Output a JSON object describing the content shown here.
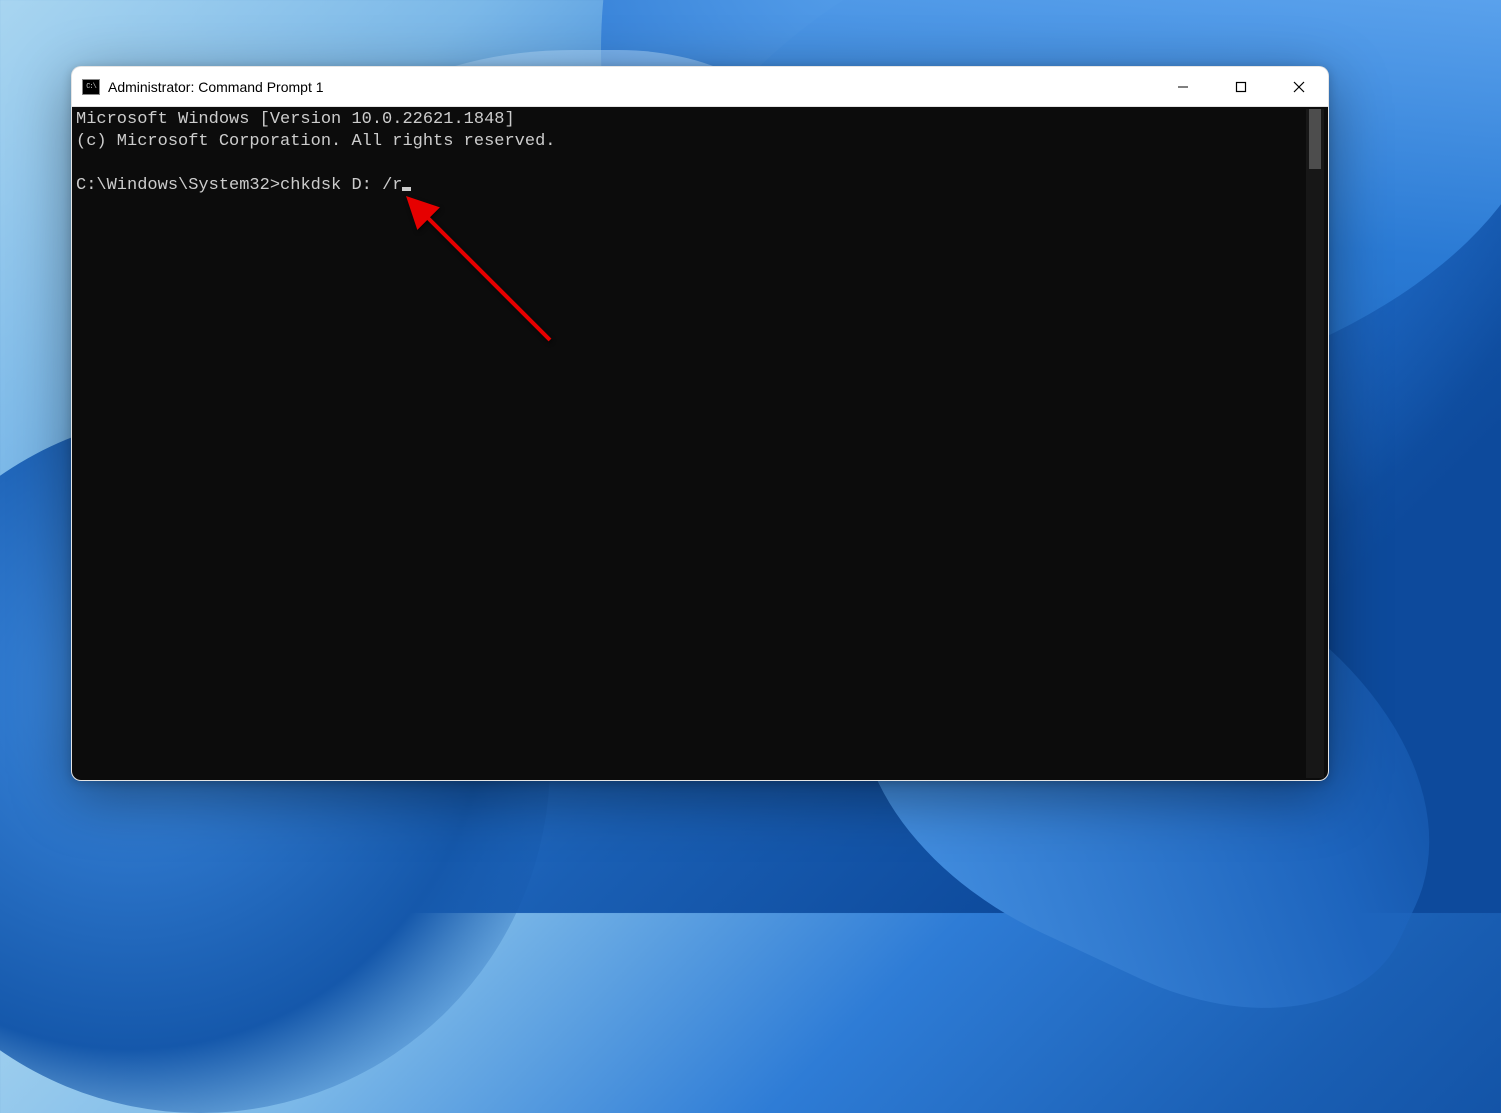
{
  "window": {
    "title": "Administrator: Command Prompt 1"
  },
  "terminal": {
    "header_line1": "Microsoft Windows [Version 10.0.22621.1848]",
    "header_line2": "(c) Microsoft Corporation. All rights reserved.",
    "prompt": "C:\\Windows\\System32>",
    "command": "chkdsk D: /r"
  }
}
